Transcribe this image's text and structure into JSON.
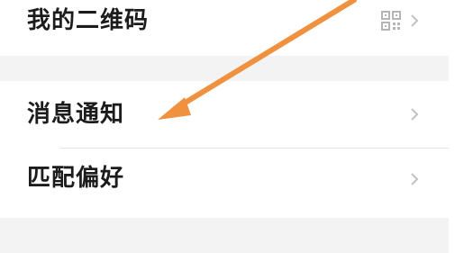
{
  "settings_list": {
    "items": [
      {
        "label": "我的二维码",
        "icon": "qr-code-icon"
      },
      {
        "label": "消息通知"
      },
      {
        "label": "匹配偏好"
      }
    ]
  },
  "annotation": {
    "arrow_color": "#f0913f"
  }
}
